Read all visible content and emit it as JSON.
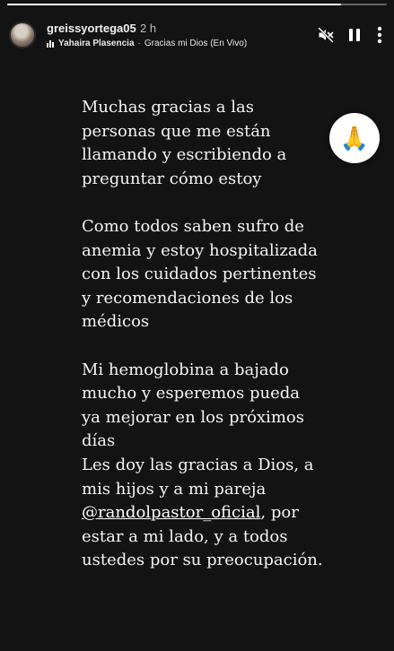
{
  "progress": 0.88,
  "header": {
    "username": "greissyortega05",
    "time": "2 h",
    "music_artist": "Yahaira Plasencia",
    "music_separator": "·",
    "music_song": "Gracias mi Dios (En Vivo)"
  },
  "icons": {
    "avatar": "profile-avatar",
    "music": "audio-bars-icon",
    "mute": "speaker-muted-icon",
    "pause": "pause-icon",
    "more": "more-vertical-icon",
    "sticker": "praying-hands-emoji"
  },
  "story": {
    "p1": "Muchas gracias a las\npersonas que me están\nllamando y escribiendo a\npreguntar cómo estoy",
    "p2": "Como todos saben sufro de\nanemia y estoy hospitalizada\ncon los cuidados pertinentes\ny recomendaciones  de los\nmédicos",
    "p3": "Mi hemoglobina a bajado\nmucho y esperemos pueda\nya mejorar en los próximos\ndías\nLes doy las gracias a Dios, a\nmis hijos y a mi pareja",
    "mention": "@randolpastor_oficial",
    "p4_after_mention": ", por\nestar a mi lado, y a todos\nustedes por su preocupación."
  },
  "sticker_emoji": "🙏"
}
